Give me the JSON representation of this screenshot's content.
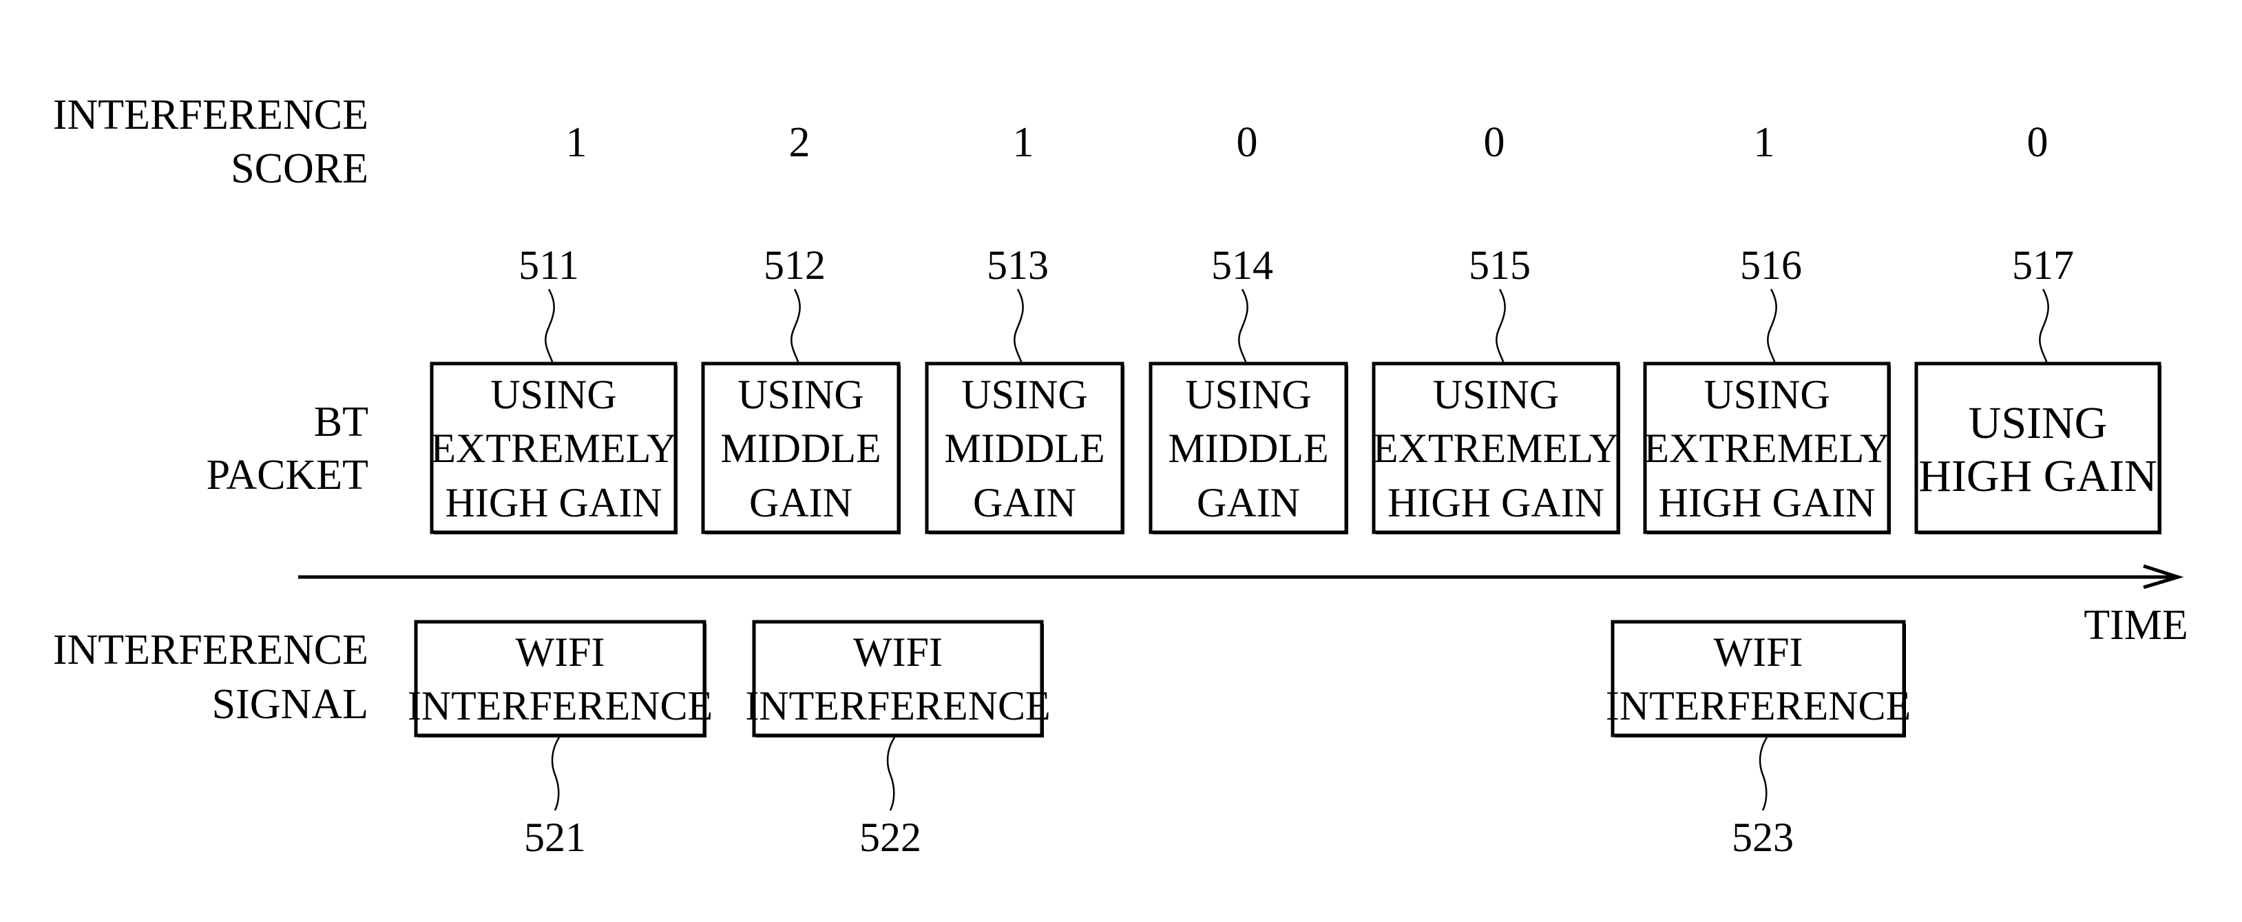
{
  "row_labels": {
    "interference_score": [
      "INTERFERENCE",
      "SCORE"
    ],
    "bt_packet": [
      "BT",
      "PACKET"
    ],
    "interference_signal": [
      "INTERFERENCE",
      "SIGNAL"
    ]
  },
  "axis": {
    "label": "TIME",
    "direction": "right"
  },
  "bt_packets": [
    {
      "ref": "511",
      "score": "1",
      "lines": [
        "USING",
        "EXTREMELY",
        "HIGH GAIN"
      ]
    },
    {
      "ref": "512",
      "score": "2",
      "lines": [
        "USING",
        "MIDDLE",
        "GAIN"
      ]
    },
    {
      "ref": "513",
      "score": "1",
      "lines": [
        "USING",
        "MIDDLE",
        "GAIN"
      ]
    },
    {
      "ref": "514",
      "score": "0",
      "lines": [
        "USING",
        "MIDDLE",
        "GAIN"
      ]
    },
    {
      "ref": "515",
      "score": "0",
      "lines": [
        "USING",
        "EXTREMELY",
        "HIGH GAIN"
      ]
    },
    {
      "ref": "516",
      "score": "1",
      "lines": [
        "USING",
        "EXTREMELY",
        "HIGH GAIN"
      ]
    },
    {
      "ref": "517",
      "score": "0",
      "lines": [
        "USING",
        "HIGH GAIN"
      ]
    }
  ],
  "interference_signals": [
    {
      "ref": "521",
      "lines": [
        "WIFI",
        "INTERFERENCE"
      ]
    },
    {
      "ref": "522",
      "lines": [
        "WIFI",
        "INTERFERENCE"
      ]
    },
    {
      "ref": "523",
      "lines": [
        "WIFI",
        "INTERFERENCE"
      ]
    }
  ],
  "colors": {
    "ink": "#000000",
    "background": "#ffffff"
  }
}
